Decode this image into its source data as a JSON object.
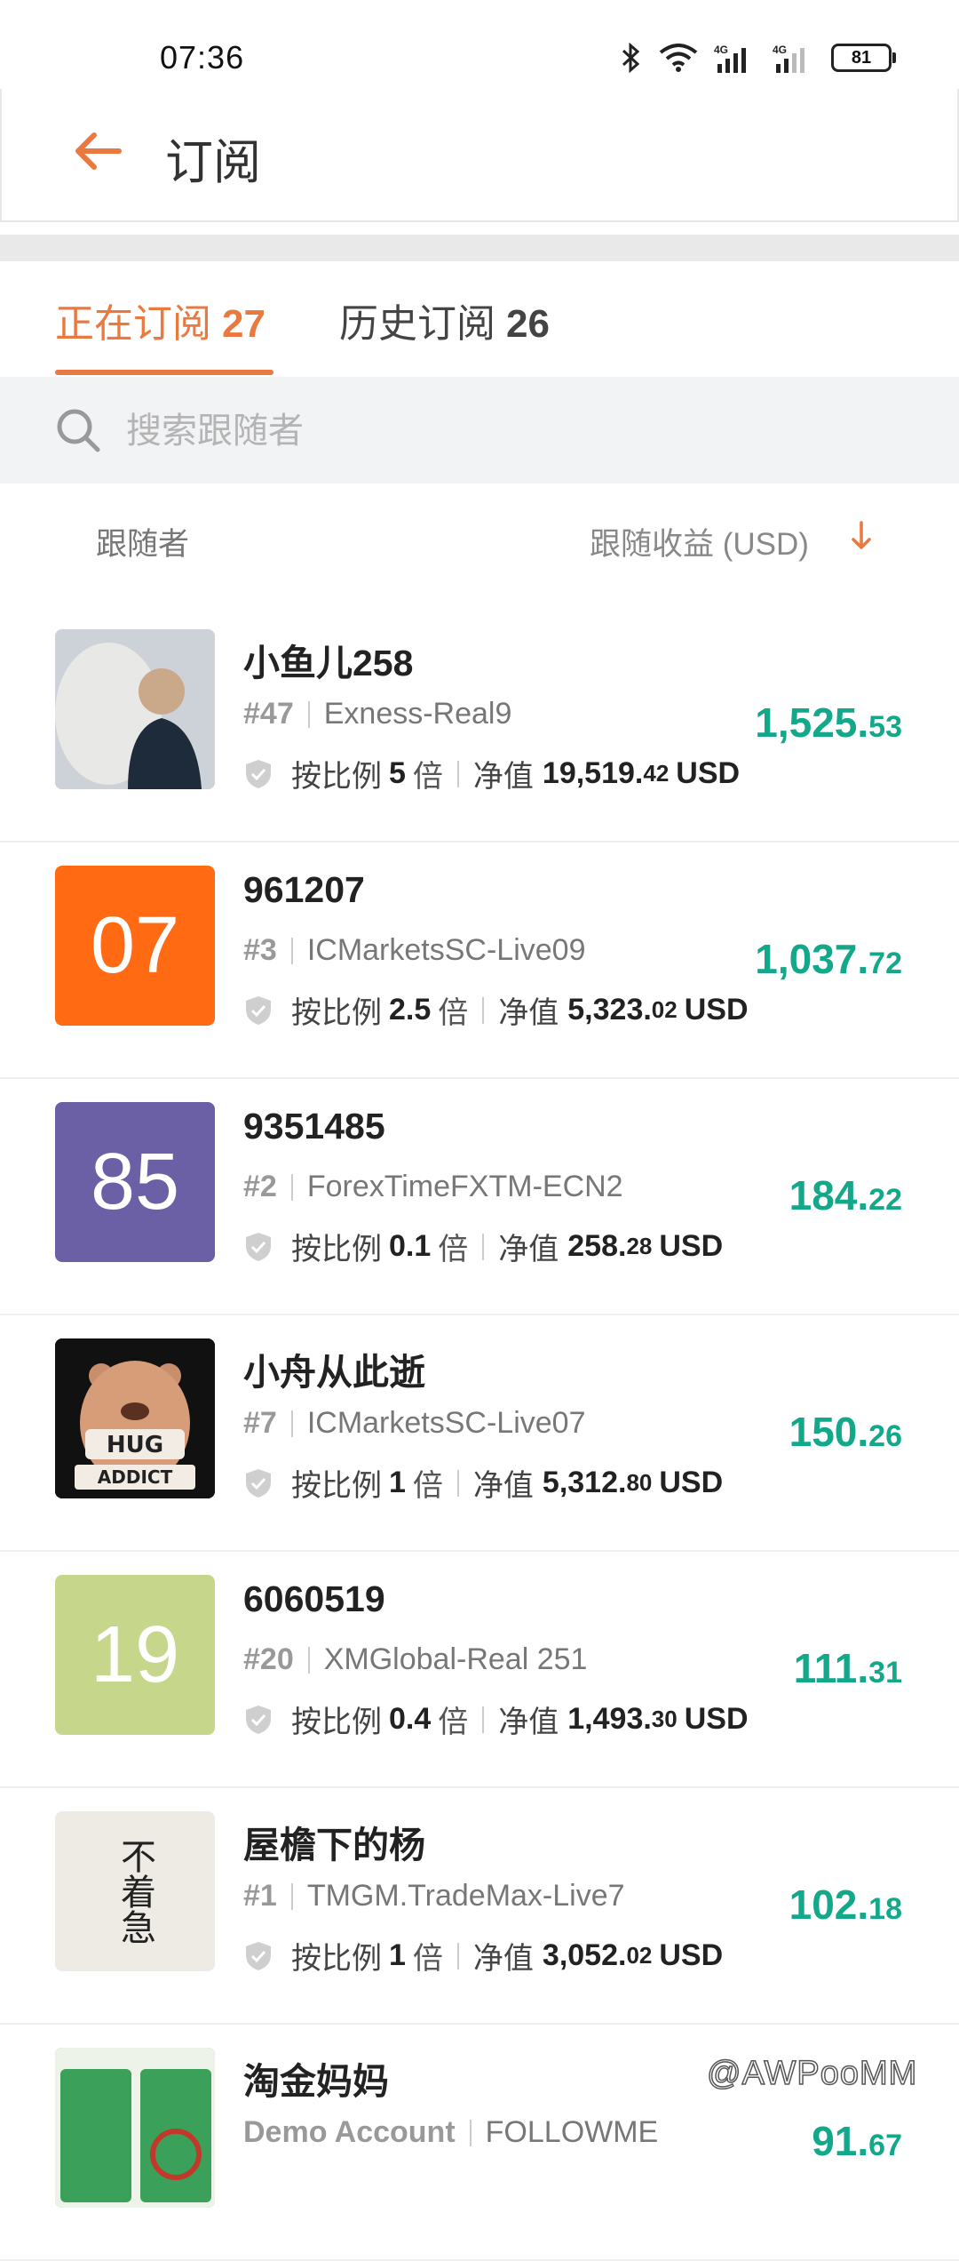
{
  "status": {
    "time": "07:36",
    "battery": "81"
  },
  "header": {
    "title": "订阅"
  },
  "tabs": [
    {
      "label": "正在订阅",
      "count": "27"
    },
    {
      "label": "历史订阅",
      "count": "26"
    }
  ],
  "search": {
    "placeholder": "搜索跟随者"
  },
  "list_header": {
    "left": "跟随者",
    "right": "跟随收益 (USD)"
  },
  "labels": {
    "ratio_prefix": "按比例",
    "ratio_suffix": "倍",
    "equity_prefix": "净值",
    "currency": "USD"
  },
  "followers": [
    {
      "name": "小鱼儿258",
      "rank": "#47",
      "server": "Exness-Real9",
      "ratio": "5",
      "equity_int": "19,519.",
      "equity_dec": "42",
      "profit_int": "1,525.",
      "profit_dec": "53",
      "avatar_text": "",
      "avatar_color": "#c9ccd0"
    },
    {
      "name": "961207",
      "rank": "#3",
      "server": "ICMarketsSC-Live09",
      "ratio": "2.5",
      "equity_int": "5,323.",
      "equity_dec": "02",
      "profit_int": "1,037.",
      "profit_dec": "72",
      "avatar_text": "07",
      "avatar_color": "#ff6a13"
    },
    {
      "name": "9351485",
      "rank": "#2",
      "server": "ForexTimeFXTM-ECN2",
      "ratio": "0.1",
      "equity_int": "258.",
      "equity_dec": "28",
      "profit_int": "184.",
      "profit_dec": "22",
      "avatar_text": "85",
      "avatar_color": "#6b5fa6"
    },
    {
      "name": "小舟从此逝",
      "rank": "#7",
      "server": "ICMarketsSC-Live07",
      "ratio": "1",
      "equity_int": "5,312.",
      "equity_dec": "80",
      "profit_int": "150.",
      "profit_dec": "26",
      "avatar_text": "HUG ADDICT",
      "avatar_color": "#111111"
    },
    {
      "name": "6060519",
      "rank": "#20",
      "server": "XMGlobal-Real 251",
      "ratio": "0.4",
      "equity_int": "1,493.",
      "equity_dec": "30",
      "profit_int": "111.",
      "profit_dec": "31",
      "avatar_text": "19",
      "avatar_color": "#c6d68a"
    },
    {
      "name": "屋檐下的杨",
      "rank": "#1",
      "server": "TMGM.TradeMax-Live7",
      "ratio": "1",
      "equity_int": "3,052.",
      "equity_dec": "02",
      "profit_int": "102.",
      "profit_dec": "18",
      "avatar_text": "不着急",
      "avatar_color": "#eeeae4"
    },
    {
      "name": "淘金妈妈",
      "rank": "Demo Account",
      "server": "FOLLOWME",
      "ratio": "",
      "equity_int": "",
      "equity_dec": "",
      "profit_int": "91.",
      "profit_dec": "67",
      "avatar_text": "",
      "avatar_color": "#3aa05a"
    }
  ],
  "watermark": "@AWPooMM",
  "colors": {
    "accent": "#e9793f",
    "profit": "#14a88a"
  }
}
